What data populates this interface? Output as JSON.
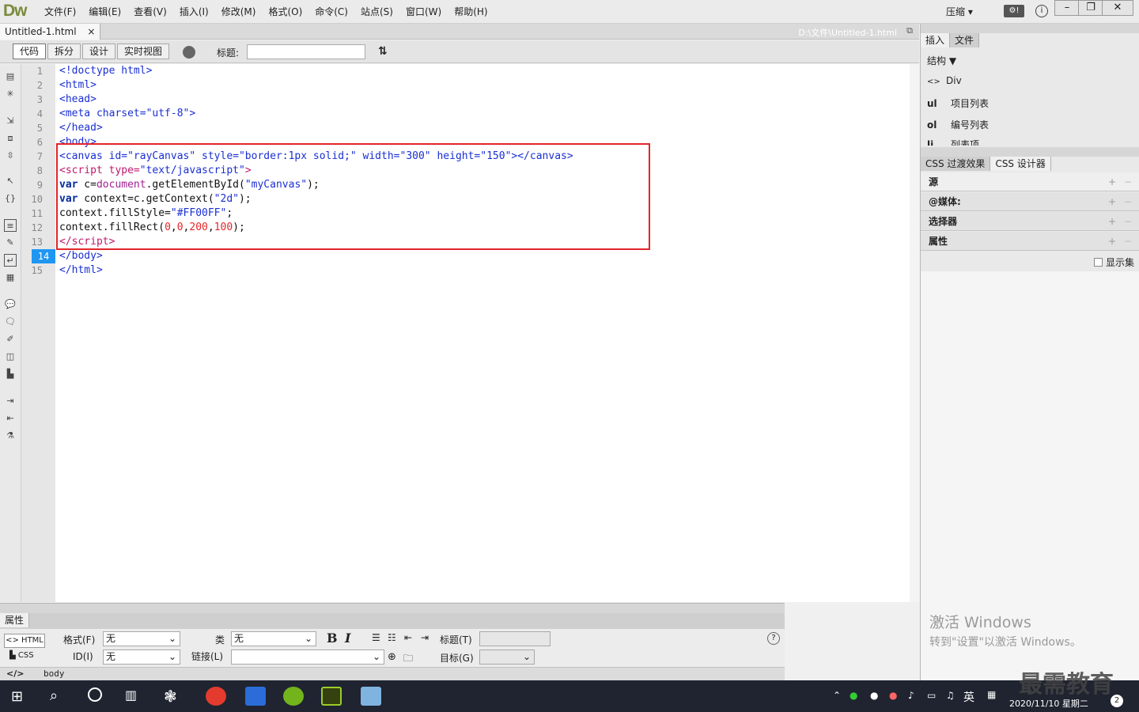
{
  "app": {
    "logo": "Dw",
    "menus": [
      "文件(F)",
      "编辑(E)",
      "查看(V)",
      "插入(I)",
      "修改(M)",
      "格式(O)",
      "命令(C)",
      "站点(S)",
      "窗口(W)",
      "帮助(H)"
    ],
    "compress": "压缩"
  },
  "doc": {
    "tab": "Untitled-1.html",
    "path": "D:\\文件\\Untitled-1.html"
  },
  "toolbar": {
    "views": [
      "代码",
      "拆分",
      "设计",
      "实时视图"
    ],
    "title_label": "标题:"
  },
  "editor": {
    "line_numbers": [
      "1",
      "2",
      "3",
      "4",
      "5",
      "6",
      "7",
      "8",
      "9",
      "10",
      "11",
      "12",
      "13",
      "14",
      "15"
    ],
    "current_line": "14"
  },
  "right": {
    "tabs_top": [
      "插入",
      "文件"
    ],
    "structure": "结构",
    "items": [
      {
        "icon": "<>",
        "label": "Div"
      },
      {
        "icon": "ul",
        "label": "项目列表"
      },
      {
        "icon": "ol",
        "label": "编号列表"
      },
      {
        "icon": "li",
        "label": "列表项"
      }
    ],
    "tabs_css": [
      "CSS 过渡效果",
      "CSS 设计器"
    ],
    "sections": [
      "源",
      "@媒体:",
      "选择器",
      "属性"
    ],
    "show_set": "显示集",
    "watermark1": "激活 Windows",
    "watermark2": "转到\"设置\"以激活 Windows。"
  },
  "props": {
    "title": "属性",
    "html_btn": "HTML",
    "css_btn": "CSS",
    "format_label": "格式(F)",
    "format_value": "无",
    "id_label": "ID(I)",
    "id_value": "无",
    "class_label": "类",
    "class_value": "无",
    "link_label": "链接(L)",
    "heading_label": "标题(T)",
    "target_label": "目标(G)",
    "bold": "B",
    "italic": "I",
    "tag": "body"
  },
  "taskbar": {
    "lang": "英",
    "date": "2020/11/10 星期二",
    "badge": "2",
    "brand": "最需教育"
  }
}
